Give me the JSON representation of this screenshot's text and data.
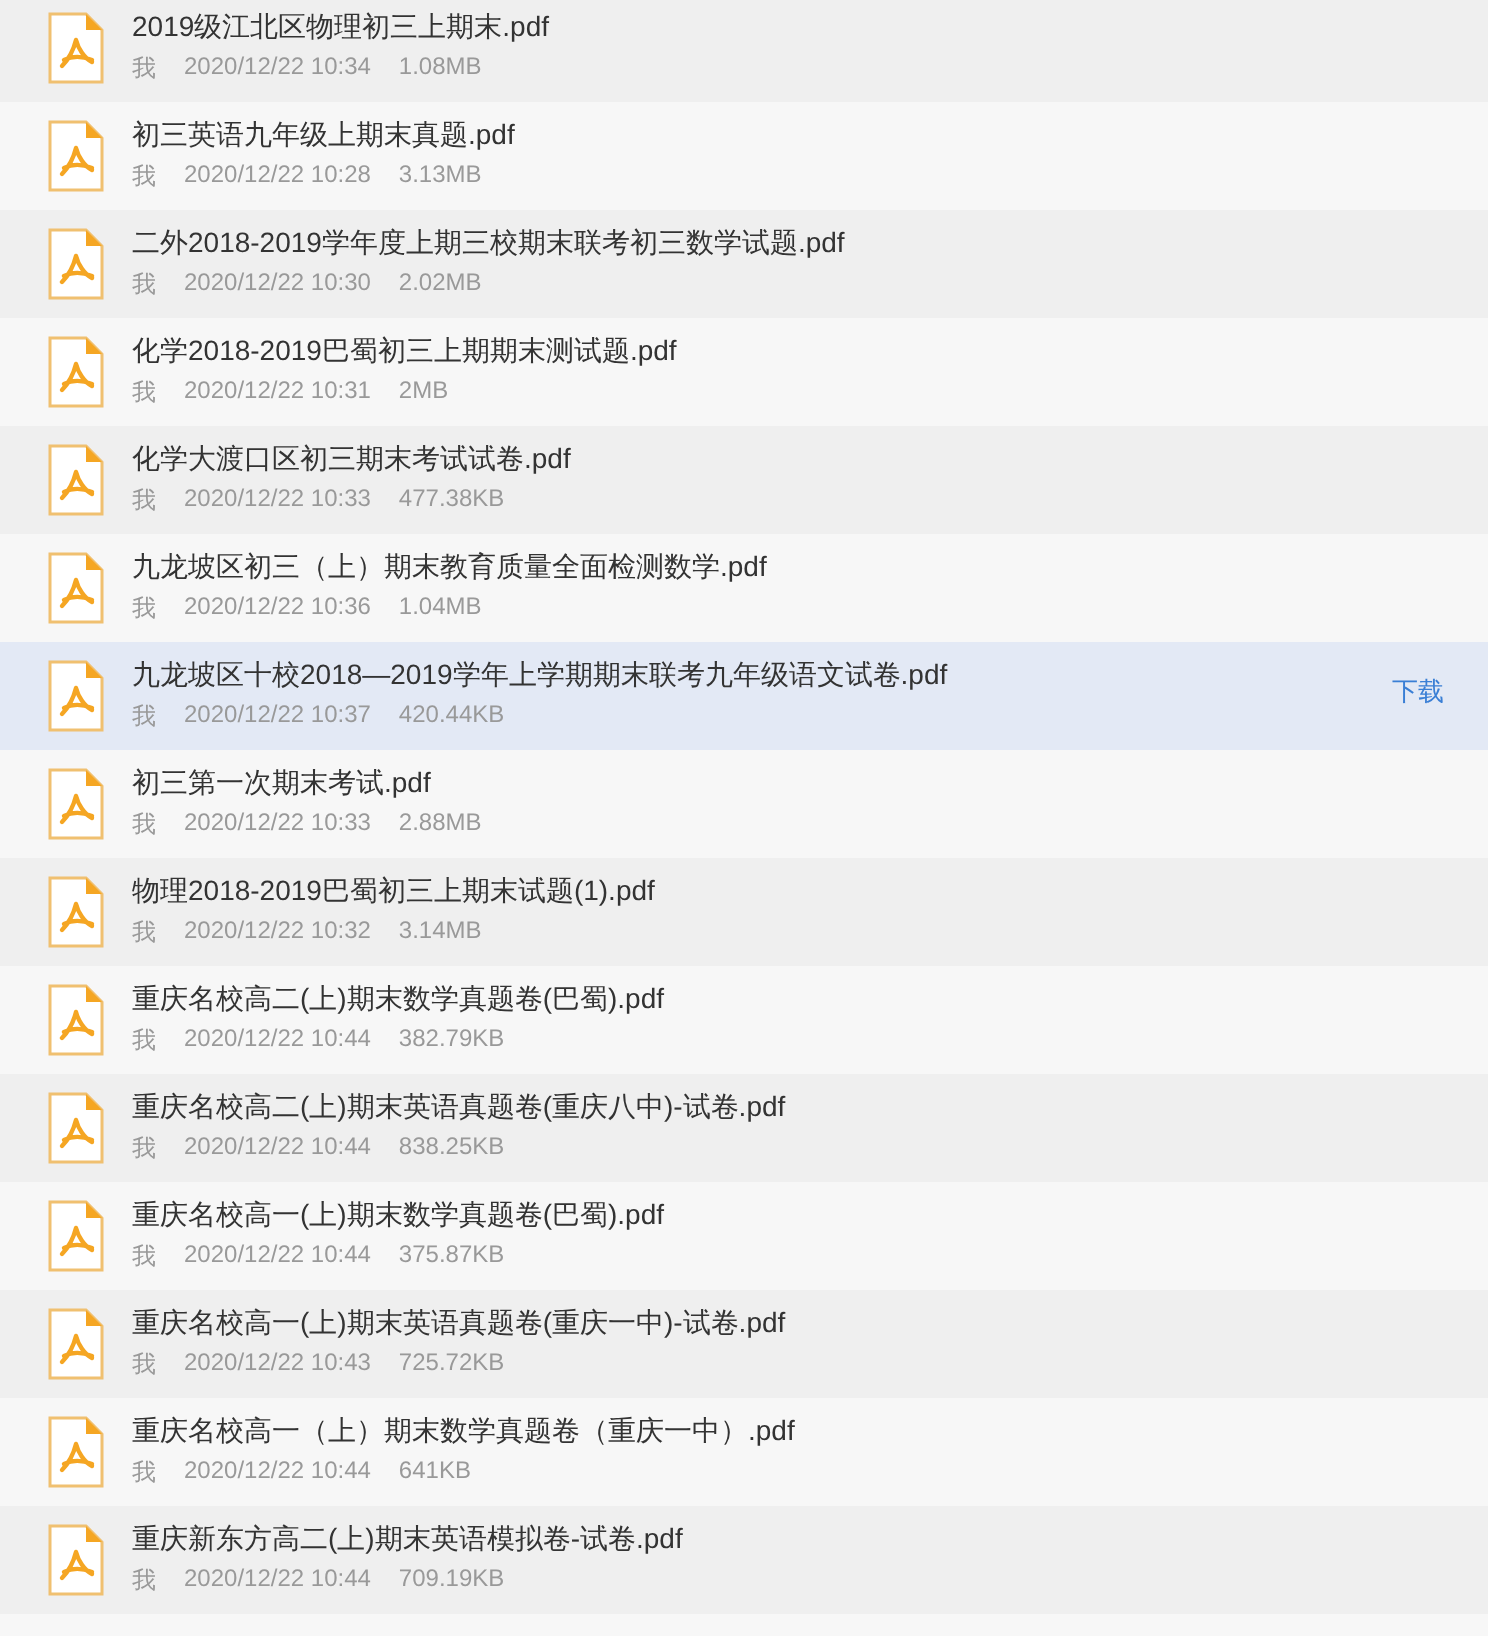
{
  "files": [
    {
      "name": "2019级江北区物理初三上期末.pdf",
      "owner": "我",
      "date": "2020/12/22 10:34",
      "size": "1.08MB",
      "hovered": false
    },
    {
      "name": "初三英语九年级上期末真题.pdf",
      "owner": "我",
      "date": "2020/12/22 10:28",
      "size": "3.13MB",
      "hovered": false
    },
    {
      "name": "二外2018-2019学年度上期三校期末联考初三数学试题.pdf",
      "owner": "我",
      "date": "2020/12/22 10:30",
      "size": "2.02MB",
      "hovered": false
    },
    {
      "name": "化学2018-2019巴蜀初三上期期末测试题.pdf",
      "owner": "我",
      "date": "2020/12/22 10:31",
      "size": "2MB",
      "hovered": false
    },
    {
      "name": "化学大渡口区初三期末考试试卷.pdf",
      "owner": "我",
      "date": "2020/12/22 10:33",
      "size": "477.38KB",
      "hovered": false
    },
    {
      "name": "九龙坡区初三（上）期末教育质量全面检测数学.pdf",
      "owner": "我",
      "date": "2020/12/22 10:36",
      "size": "1.04MB",
      "hovered": false
    },
    {
      "name": "九龙坡区十校2018—2019学年上学期期末联考九年级语文试卷.pdf",
      "owner": "我",
      "date": "2020/12/22 10:37",
      "size": "420.44KB",
      "hovered": true,
      "action": "下载"
    },
    {
      "name": "初三第一次期末考试.pdf",
      "owner": "我",
      "date": "2020/12/22 10:33",
      "size": "2.88MB",
      "hovered": false
    },
    {
      "name": "物理2018-2019巴蜀初三上期末试题(1).pdf",
      "owner": "我",
      "date": "2020/12/22 10:32",
      "size": "3.14MB",
      "hovered": false
    },
    {
      "name": "重庆名校高二(上)期末数学真题卷(巴蜀).pdf",
      "owner": "我",
      "date": "2020/12/22 10:44",
      "size": "382.79KB",
      "hovered": false
    },
    {
      "name": "重庆名校高二(上)期末英语真题卷(重庆八中)-试卷.pdf",
      "owner": "我",
      "date": "2020/12/22 10:44",
      "size": "838.25KB",
      "hovered": false
    },
    {
      "name": "重庆名校高一(上)期末数学真题卷(巴蜀).pdf",
      "owner": "我",
      "date": "2020/12/22 10:44",
      "size": "375.87KB",
      "hovered": false
    },
    {
      "name": "重庆名校高一(上)期末英语真题卷(重庆一中)-试卷.pdf",
      "owner": "我",
      "date": "2020/12/22 10:43",
      "size": "725.72KB",
      "hovered": false
    },
    {
      "name": "重庆名校高一（上）期末数学真题卷（重庆一中）.pdf",
      "owner": "我",
      "date": "2020/12/22 10:44",
      "size": "641KB",
      "hovered": false
    },
    {
      "name": "重庆新东方高二(上)期末英语模拟卷-试卷.pdf",
      "owner": "我",
      "date": "2020/12/22 10:44",
      "size": "709.19KB",
      "hovered": false
    }
  ]
}
